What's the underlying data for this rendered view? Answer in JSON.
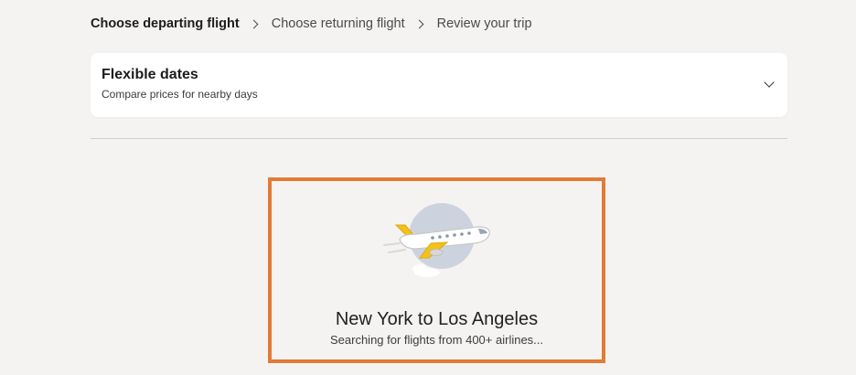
{
  "breadcrumb": {
    "steps": [
      {
        "label": "Choose departing flight",
        "active": true
      },
      {
        "label": "Choose returning flight",
        "active": false
      },
      {
        "label": "Review your trip",
        "active": false
      }
    ]
  },
  "flexible_dates": {
    "title": "Flexible dates",
    "subtitle": "Compare prices for nearby days",
    "icon": "chevron-down-icon"
  },
  "loading": {
    "route": "New York to Los Angeles",
    "status": "Searching for flights from 400+ airlines...",
    "illustration": "airplane-icon",
    "highlight_color": "#e37b35"
  }
}
